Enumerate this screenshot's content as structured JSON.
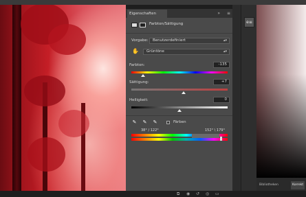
{
  "panel": {
    "tab_label": "Eigenschaften",
    "tab_icons": "»",
    "menu_icon": "≡",
    "adjustment_title": "Farbton/Sättigung",
    "preset_label": "Vorgabe:",
    "preset_value": "Benutzerdefiniert",
    "channel_value": "Grüntöne",
    "hue_label": "Farbton:",
    "hue_value": "-135",
    "saturation_label": "Sättigung:",
    "saturation_value": "+7",
    "lightness_label": "Helligkeit:",
    "lightness_value": "0",
    "colorize_label": "Färben",
    "range_left": "38° / 122°",
    "range_right": "152° \\ 179°",
    "slider_levels": {
      "hue": 0.12,
      "saturation": 0.54,
      "lightness": 0.5
    }
  },
  "right_tool": {
    "button_label": "e≡"
  },
  "bottom_tabs": [
    "Bibliotheken",
    "Korrekt"
  ]
}
